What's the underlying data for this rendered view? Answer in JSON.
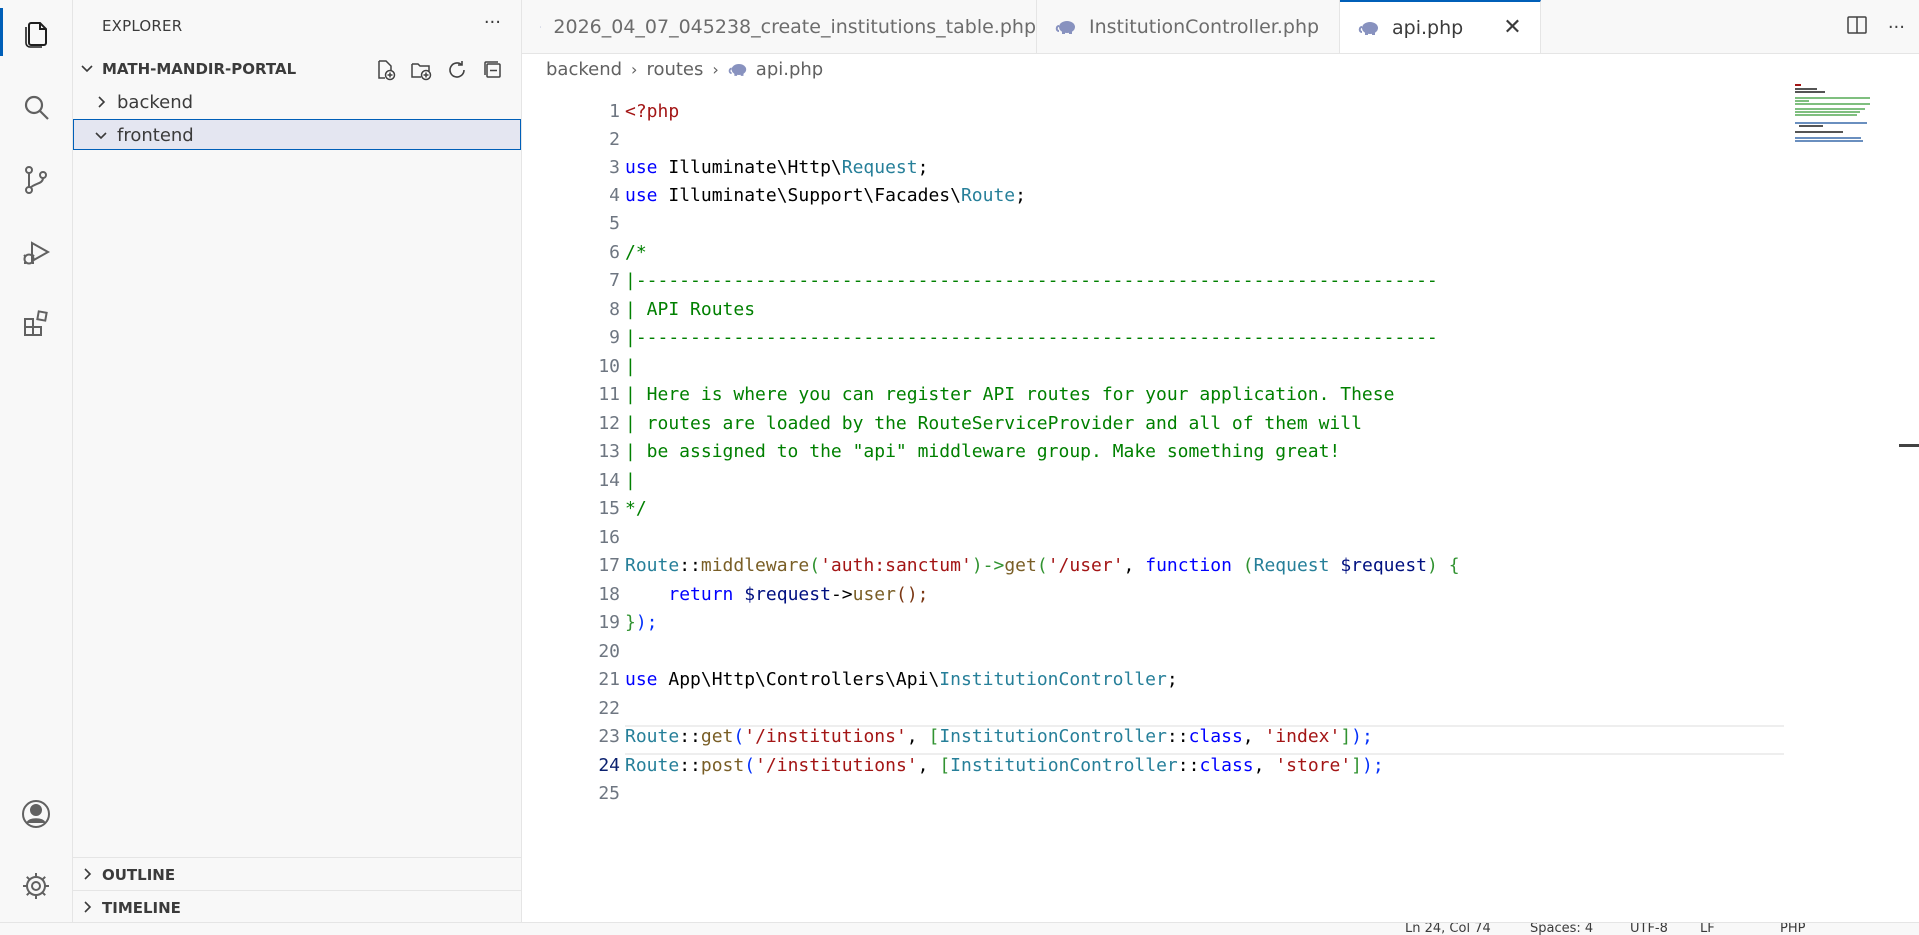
{
  "activity_bar": {
    "items": [
      "explorer-icon",
      "search-icon",
      "source-control-icon",
      "run-debug-icon",
      "extensions-icon",
      "account-icon",
      "manage-gear-icon"
    ]
  },
  "sidebar": {
    "header": "EXPLORER",
    "more": "···",
    "folder": "MATH-MANDIR-PORTAL",
    "tree": [
      {
        "label": "backend"
      },
      {
        "label": "frontend"
      }
    ],
    "sections": {
      "outline": "OUTLINE",
      "timeline": "TIMELINE"
    }
  },
  "tabs": [
    {
      "label": "2026_04_07_045238_create_institutions_table.php"
    },
    {
      "label": "InstitutionController.php"
    },
    {
      "label": "api.php",
      "close": "✕"
    }
  ],
  "breadcrumb": {
    "part1": "backend",
    "part2": "routes",
    "part3": "api.php",
    "sep": "›"
  },
  "editor": {
    "line_numbers": [
      "1",
      "2",
      "3",
      "4",
      "5",
      "6",
      "7",
      "8",
      "9",
      "10",
      "11",
      "12",
      "13",
      "14",
      "15",
      "16",
      "17",
      "18",
      "19",
      "20",
      "21",
      "22",
      "23",
      "24",
      "25"
    ],
    "current_line": "24",
    "lines": {
      "l1": "<?php",
      "l3a": "use",
      "l3b": " Illuminate\\Http\\",
      "l3c": "Request",
      "l3d": ";",
      "l4a": "use",
      "l4b": " Illuminate\\Support\\Facades\\",
      "l4c": "Route",
      "l4d": ";",
      "l6": "/*",
      "l7": "|--------------------------------------------------------------------------",
      "l8": "| API Routes",
      "l9": "|--------------------------------------------------------------------------",
      "l10": "|",
      "l11": "| Here is where you can register API routes for your application. These",
      "l12": "| routes are loaded by the RouteServiceProvider and all of them will",
      "l13": "| be assigned to the \"api\" middleware group. Make something great!",
      "l14": "|",
      "l15": "*/",
      "l17a": "Route",
      "l17b": "::",
      "l17c": "middleware",
      "l17d": "(",
      "l17e": "'auth:sanctum'",
      "l17f": ")->",
      "l17g": "get",
      "l17h": "(",
      "l17i": "'/user'",
      "l17j": ", ",
      "l17k": "function",
      "l17l": " (",
      "l17m": "Request",
      "l17n": " ",
      "l17o": "$request",
      "l17p": ") {",
      "l18a": "    ",
      "l18b": "return",
      "l18c": " ",
      "l18d": "$request",
      "l18e": "->",
      "l18f": "user",
      "l18g": "();",
      "l19a": "}",
      "l19b": ");",
      "l21a": "use",
      "l21b": " App\\Http\\Controllers\\Api\\",
      "l21c": "InstitutionController",
      "l21d": ";",
      "l23a": "Route",
      "l23b": "::",
      "l23c": "get",
      "l23d": "(",
      "l23e": "'/institutions'",
      "l23f": ", ",
      "l23g": "[",
      "l23h": "InstitutionController",
      "l23i": "::",
      "l23j": "class",
      "l23k": ", ",
      "l23l": "'index'",
      "l23m": "]",
      "l23n": ");",
      "l24a": "Route",
      "l24b": "::",
      "l24c": "post",
      "l24d": "(",
      "l24e": "'/institutions'",
      "l24f": ", ",
      "l24g": "[",
      "l24h": "InstitutionController",
      "l24i": "::",
      "l24j": "class",
      "l24k": ", ",
      "l24l": "'store'",
      "l24m": "]",
      "l24n": ");"
    }
  },
  "statusbar": {
    "position": "Ln 24, Col 74",
    "spaces": "Spaces: 4",
    "encoding": "UTF-8",
    "eol": "LF",
    "language": "PHP"
  },
  "colors": {
    "accent": "#005fb8",
    "keyword": "#0000ff",
    "class": "#267f99",
    "function": "#795e26",
    "string": "#a31515",
    "comment": "#008000",
    "variable": "#001080"
  }
}
